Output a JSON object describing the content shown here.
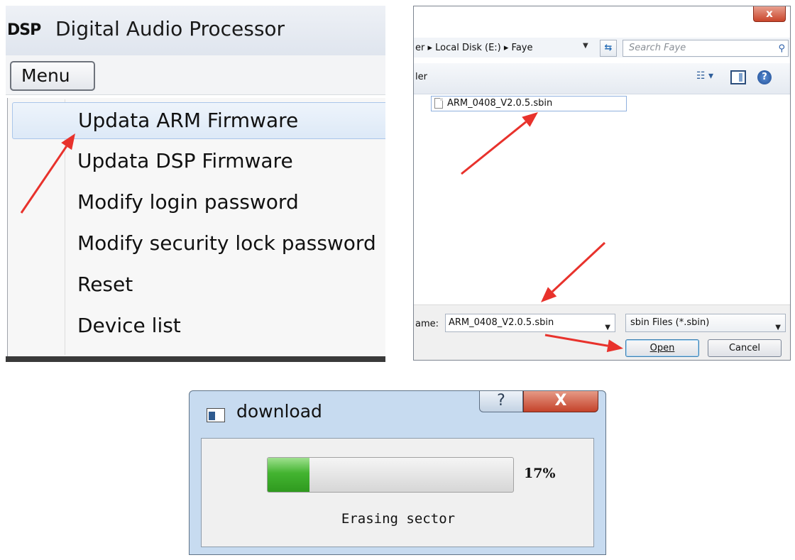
{
  "app_window": {
    "logo": "DSP",
    "title": "Digital Audio Processor",
    "menu_button": "Menu",
    "menu_items": [
      "Updata ARM Firmware",
      "Updata DSP Firmware",
      "Modify login password",
      "Modify security lock password",
      "Reset",
      "Device list"
    ],
    "highlighted_index": 0
  },
  "open_dialog": {
    "close_glyph": "x",
    "breadcrumb": "er  ▸ Local Disk (E:)  ▸ Faye",
    "refresh_glyph": "⇆",
    "search_placeholder": "Search Faye",
    "search_icon": "search-icon",
    "toolbar_label": "ler",
    "view_glyph": "☷ ▾",
    "help_glyph": "?",
    "files": [
      "ARM_0408_V2.0.5.sbin"
    ],
    "filename_label": "ame:",
    "filename_value": "ARM_0408_V2.0.5.sbin",
    "filetype_value": "sbin Files (*.sbin)",
    "open_label": "Open",
    "cancel_label": "Cancel"
  },
  "download_dialog": {
    "title": "download",
    "help_glyph": "?",
    "close_glyph": "X",
    "progress_percent": 17,
    "progress_text": "17%",
    "status": "Erasing sector"
  },
  "colors": {
    "arrow": "#e8322c",
    "progress_green": "#43b430",
    "menu_highlight": "#dde9f7"
  }
}
